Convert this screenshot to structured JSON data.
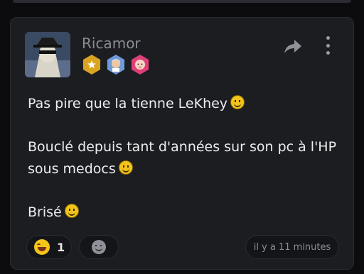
{
  "post": {
    "username": "Ricamor",
    "badges": [
      "star-badge-icon",
      "man-avatar-badge-icon",
      "baby-avatar-badge-icon"
    ],
    "paragraphs": [
      {
        "text": "Pas pire que la tienne LeKhey",
        "emoji": "smile-emoji-icon"
      },
      {
        "text": "Bouclé depuis tant d'années sur son pc à l'HP sous medocs",
        "emoji": "smile-emoji-icon"
      },
      {
        "text": "Brisé",
        "emoji": "smile-emoji-icon"
      }
    ],
    "reactions": {
      "laugh_count": "1"
    },
    "timestamp": "il y a 11 minutes"
  },
  "colors": {
    "card_bg": "#1c1d21",
    "page_bg": "#0c0c0e",
    "username": "#8b8c96",
    "badge_star": "#d9a520",
    "badge_man": "#6f9bd9",
    "badge_baby": "#e0407a"
  }
}
